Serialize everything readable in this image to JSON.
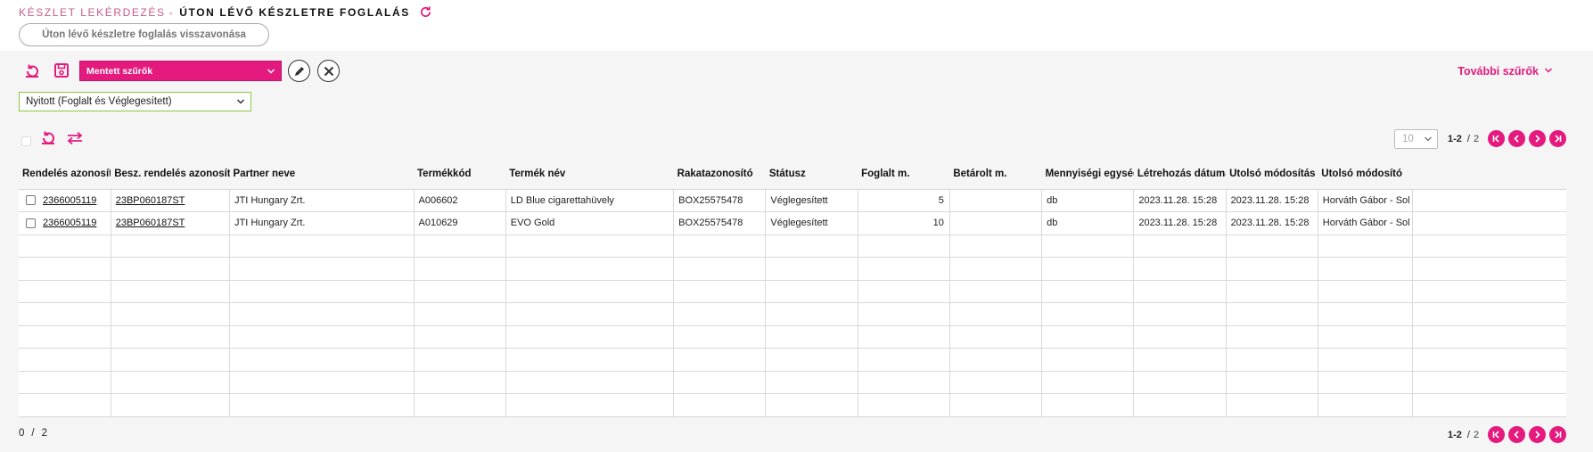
{
  "header": {
    "breadcrumb_parent": "KÉSZLET LEKÉRDEZÉS",
    "breadcrumb_sep": "-",
    "page_title": "ÚTON LÉVŐ KÉSZLETRE FOGLALÁS",
    "revoke_button": "Úton lévő készletre foglalás visszavonása"
  },
  "filters": {
    "saved_filters": "Mentett szűrők",
    "more_filters": "További szűrők",
    "status_selected": "Nyitott (Foglalt és Véglegesített)"
  },
  "pager": {
    "page_size": "10",
    "range": "1-2",
    "slash": "/",
    "total": "2"
  },
  "table": {
    "columns": [
      "Rendelés azonosító",
      "Besz. rendelés azonosító",
      "Partner neve",
      "Termékkód",
      "Termék név",
      "Rakatazonosító",
      "Státusz",
      "Foglalt m.",
      "Betárolt m.",
      "Mennyiségi egység",
      "Létrehozás dátuma",
      "Utolsó módosítás",
      "Utolsó módosító"
    ],
    "rows": [
      {
        "order_id": "2366005119",
        "purchase_order_id": "23BP060187ST",
        "partner": "JTI Hungary Zrt.",
        "product_code": "A006602",
        "product_name": "LD Blue cigarettahüvely",
        "pallet_id": "BOX25575478",
        "status": "Véglegesített",
        "reserved_qty": "5",
        "stored_qty": "",
        "unit": "db",
        "created": "2023.11.28. 15:28",
        "modified": "2023.11.28. 15:28",
        "modifier": "Horváth Gábor - Sol"
      },
      {
        "order_id": "2366005119",
        "purchase_order_id": "23BP060187ST",
        "partner": "JTI Hungary Zrt.",
        "product_code": "A010629",
        "product_name": "EVO Gold",
        "pallet_id": "BOX25575478",
        "status": "Véglegesített",
        "reserved_qty": "10",
        "stored_qty": "",
        "unit": "db",
        "created": "2023.11.28. 15:28",
        "modified": "2023.11.28. 15:28",
        "modifier": "Horváth Gábor - Sol"
      }
    ]
  },
  "footer": {
    "selected": "0",
    "slash": "/",
    "total": "2"
  },
  "colors": {
    "accent": "#e41a7e",
    "status_border": "#8cc63f"
  },
  "icons": [
    "refresh-icon",
    "reset-icon",
    "save-icon",
    "edit-icon",
    "close-icon",
    "chevron-down-icon",
    "swap-icon",
    "first-page-icon",
    "prev-page-icon",
    "next-page-icon",
    "last-page-icon"
  ]
}
